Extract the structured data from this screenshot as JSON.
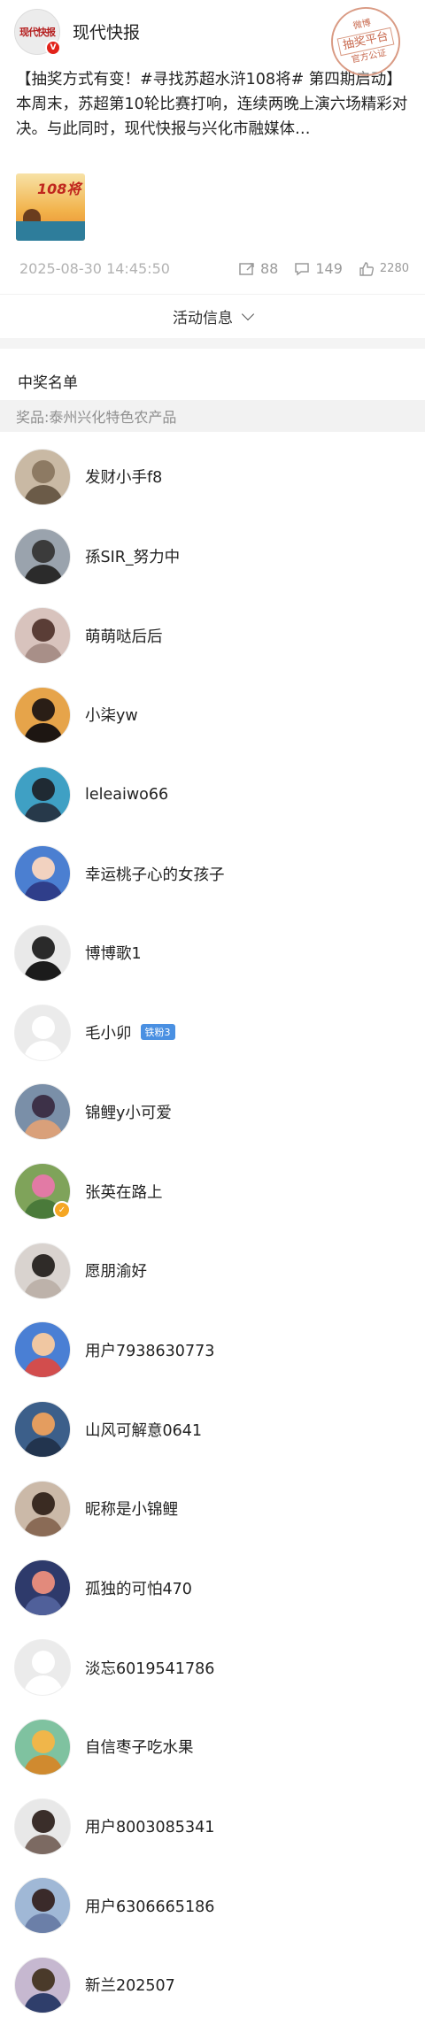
{
  "account": {
    "logo_text": "现代快报",
    "name": "现代快报",
    "verified_glyph": "V"
  },
  "stamp": {
    "top": "微博",
    "mid": "抽奖平台",
    "bottom": "官方公证"
  },
  "post": {
    "text": "【抽奖方式有变！#寻找苏超水浒108将# 第四期启动】本周末，苏超第10轮比赛打响，连续两晚上演六场精彩对决。与此同时，现代快报与兴化市融媒体…",
    "thumb_text": "108将",
    "time": "2025-08-30 14:45:50",
    "repost_count": "88",
    "comment_count": "149",
    "like_count": "2280"
  },
  "activity_label": "活动信息",
  "winners_title": "中奖名单",
  "prize_label": "奖品:泰州兴化特色农产品",
  "winners": [
    {
      "name": "发财小手f8",
      "bg": "#c9b9a4",
      "head": "#8d7a63",
      "body": "#6b5b48"
    },
    {
      "name": "孫SIR_努力中",
      "bg": "#9aa3ad",
      "head": "#3b3b3b",
      "body": "#2b2b2b"
    },
    {
      "name": "萌萌哒后后",
      "bg": "#d8c3bd",
      "head": "#5a3d36",
      "body": "#a88f88"
    },
    {
      "name": "小柒yw",
      "bg": "#e6a44a",
      "head": "#2a1e16",
      "body": "#1d1612"
    },
    {
      "name": "leleaiwo66",
      "bg": "#3fa0c4",
      "head": "#1f2a33",
      "body": "#27394a"
    },
    {
      "name": "幸运桃子心的女孩子",
      "bg": "#4b7fd1",
      "head": "#f2d2c0",
      "body": "#2f3e8a"
    },
    {
      "name": "博博歌1",
      "bg": "#e9e9e9",
      "head": "#2a2a2a",
      "body": "#1b1b1b"
    },
    {
      "name": "毛小卯",
      "bg": "#ebebeb",
      "head": "#ffffff",
      "body": "#ffffff",
      "badge": "铁粉3"
    },
    {
      "name": "锦鲤y小可爱",
      "bg": "#7a8fa8",
      "head": "#3d3148",
      "body": "#d9a07a"
    },
    {
      "name": "张英在路上",
      "bg": "#7fa35a",
      "head": "#e27aa5",
      "body": "#4a7a3a",
      "verified": true
    },
    {
      "name": "愿朋渝好",
      "bg": "#d9d3cf",
      "head": "#2f2b28",
      "body": "#bdb2aa"
    },
    {
      "name": "用户7938630773",
      "bg": "#4a7fd4",
      "head": "#f0c7a2",
      "body": "#d24d4d"
    },
    {
      "name": "山风可解意0641",
      "bg": "#3c5f8a",
      "head": "#e49d5f",
      "body": "#22344e"
    },
    {
      "name": "昵称是小锦鲤",
      "bg": "#cbb9a8",
      "head": "#3a2b22",
      "body": "#8a6b56"
    },
    {
      "name": "孤独的可怕470",
      "bg": "#2e3a6b",
      "head": "#e28a7c",
      "body": "#50609a"
    },
    {
      "name": "淡忘6019541786",
      "bg": "#ebebeb",
      "head": "#ffffff",
      "body": "#ffffff"
    },
    {
      "name": "自信枣子吃水果",
      "bg": "#7fc2a0",
      "head": "#f0b64a",
      "body": "#d08a2f"
    },
    {
      "name": "用户8003085341",
      "bg": "#e8e8e8",
      "head": "#3a2e2a",
      "body": "#7c6a62"
    },
    {
      "name": "用户6306665186",
      "bg": "#a0b8d6",
      "head": "#3a2a2a",
      "body": "#6b7fa8"
    },
    {
      "name": "新兰202507",
      "bg": "#c6b8d0",
      "head": "#4a3a2a",
      "body": "#2f3e6b"
    }
  ],
  "colors": {
    "accent": "#4a90e2",
    "stamp": "#c86a4f",
    "verified_red": "#e2231a",
    "verified_gold": "#f5a623"
  }
}
